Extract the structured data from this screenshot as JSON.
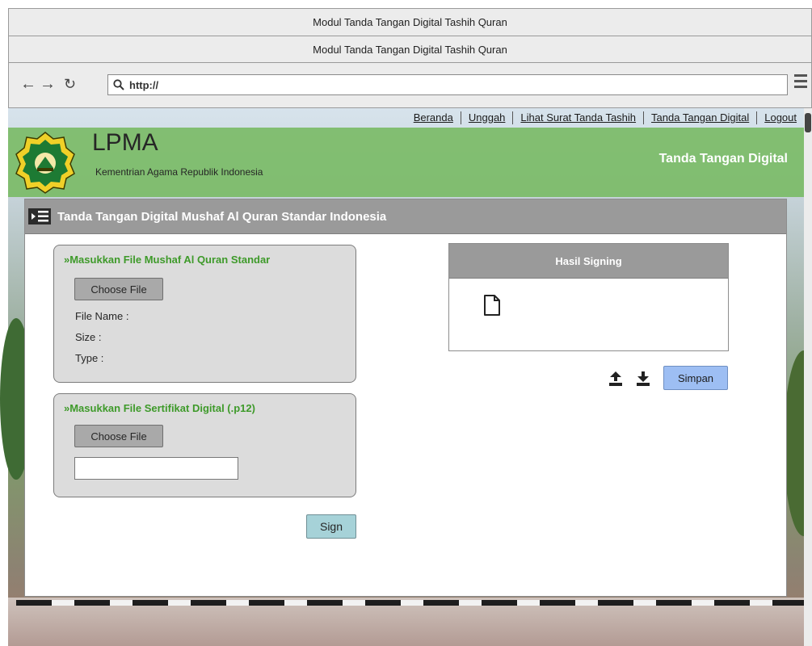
{
  "window": {
    "title": "Modul Tanda Tangan Digital Tashih Quran"
  },
  "tab": {
    "title": "Modul Tanda Tangan Digital Tashih Quran"
  },
  "browser": {
    "url": "http://"
  },
  "nav": {
    "links": [
      "Beranda",
      "Unggah",
      "Lihat Surat Tanda Tashih",
      "Tanda Tangan Digital",
      "Logout"
    ]
  },
  "header": {
    "title": "LPMA",
    "subtitle": "Kementrian Agama Republik Indonesia",
    "right_label": "Tanda Tangan Digital"
  },
  "panel": {
    "title": "Tanda Tangan Digital Mushaf Al Quran Standar Indonesia"
  },
  "mushaf_card": {
    "title": "»Masukkan File Mushaf Al Quran Standar",
    "choose_label": "Choose File",
    "file_name_label": "File Name :",
    "size_label": "Size :",
    "type_label": "Type :"
  },
  "cert_card": {
    "title": "»Masukkan File Sertifikat Digital (.p12)",
    "choose_label": "Choose File",
    "input_value": ""
  },
  "sign_button": {
    "label": "Sign"
  },
  "result": {
    "title": "Hasil Signing",
    "save_label": "Simpan"
  },
  "icons": {
    "back": "back-arrow-icon",
    "forward": "forward-arrow-icon",
    "reload": "reload-icon",
    "search": "search-icon",
    "menu": "hamburger-menu-icon",
    "logo": "kemenag-logo",
    "list": "list-icon",
    "file": "file-icon",
    "upload": "upload-icon",
    "download": "download-icon"
  },
  "colors": {
    "banner": "#76BA61",
    "card_title": "#3E9A2A",
    "save_button": "#9DBEF3",
    "sign_button": "#A6D2D8",
    "panel_header": "#9A9A9A"
  }
}
